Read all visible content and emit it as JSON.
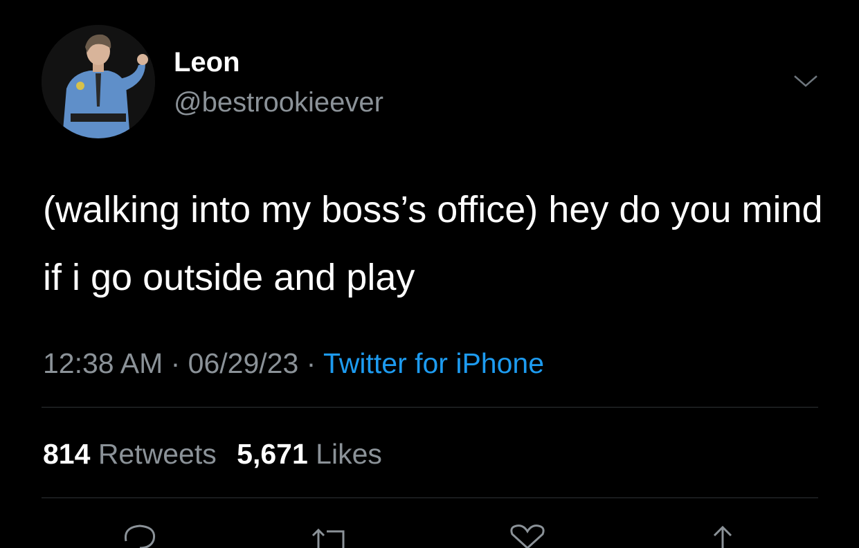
{
  "tweet": {
    "author": {
      "display_name": "Leon",
      "handle": "@bestrookieever"
    },
    "text": "(walking into my boss’s office) hey do you mind if i go outside and play",
    "timestamp": {
      "time": "12:38 AM",
      "separator1": " · ",
      "date": "06/29/23",
      "separator2": " · ",
      "source": "Twitter for iPhone"
    },
    "stats": {
      "retweets_count": "814",
      "retweets_label": "Retweets",
      "likes_count": "5,671",
      "likes_label": "Likes"
    },
    "actions": [
      {
        "icon": "reply-icon"
      },
      {
        "icon": "retweet-icon"
      },
      {
        "icon": "like-icon"
      },
      {
        "icon": "share-icon"
      }
    ]
  },
  "colors": {
    "background": "#000000",
    "text_primary": "#ffffff",
    "text_secondary": "#8b9298",
    "link": "#1d9bf0",
    "divider": "#2f3336"
  }
}
